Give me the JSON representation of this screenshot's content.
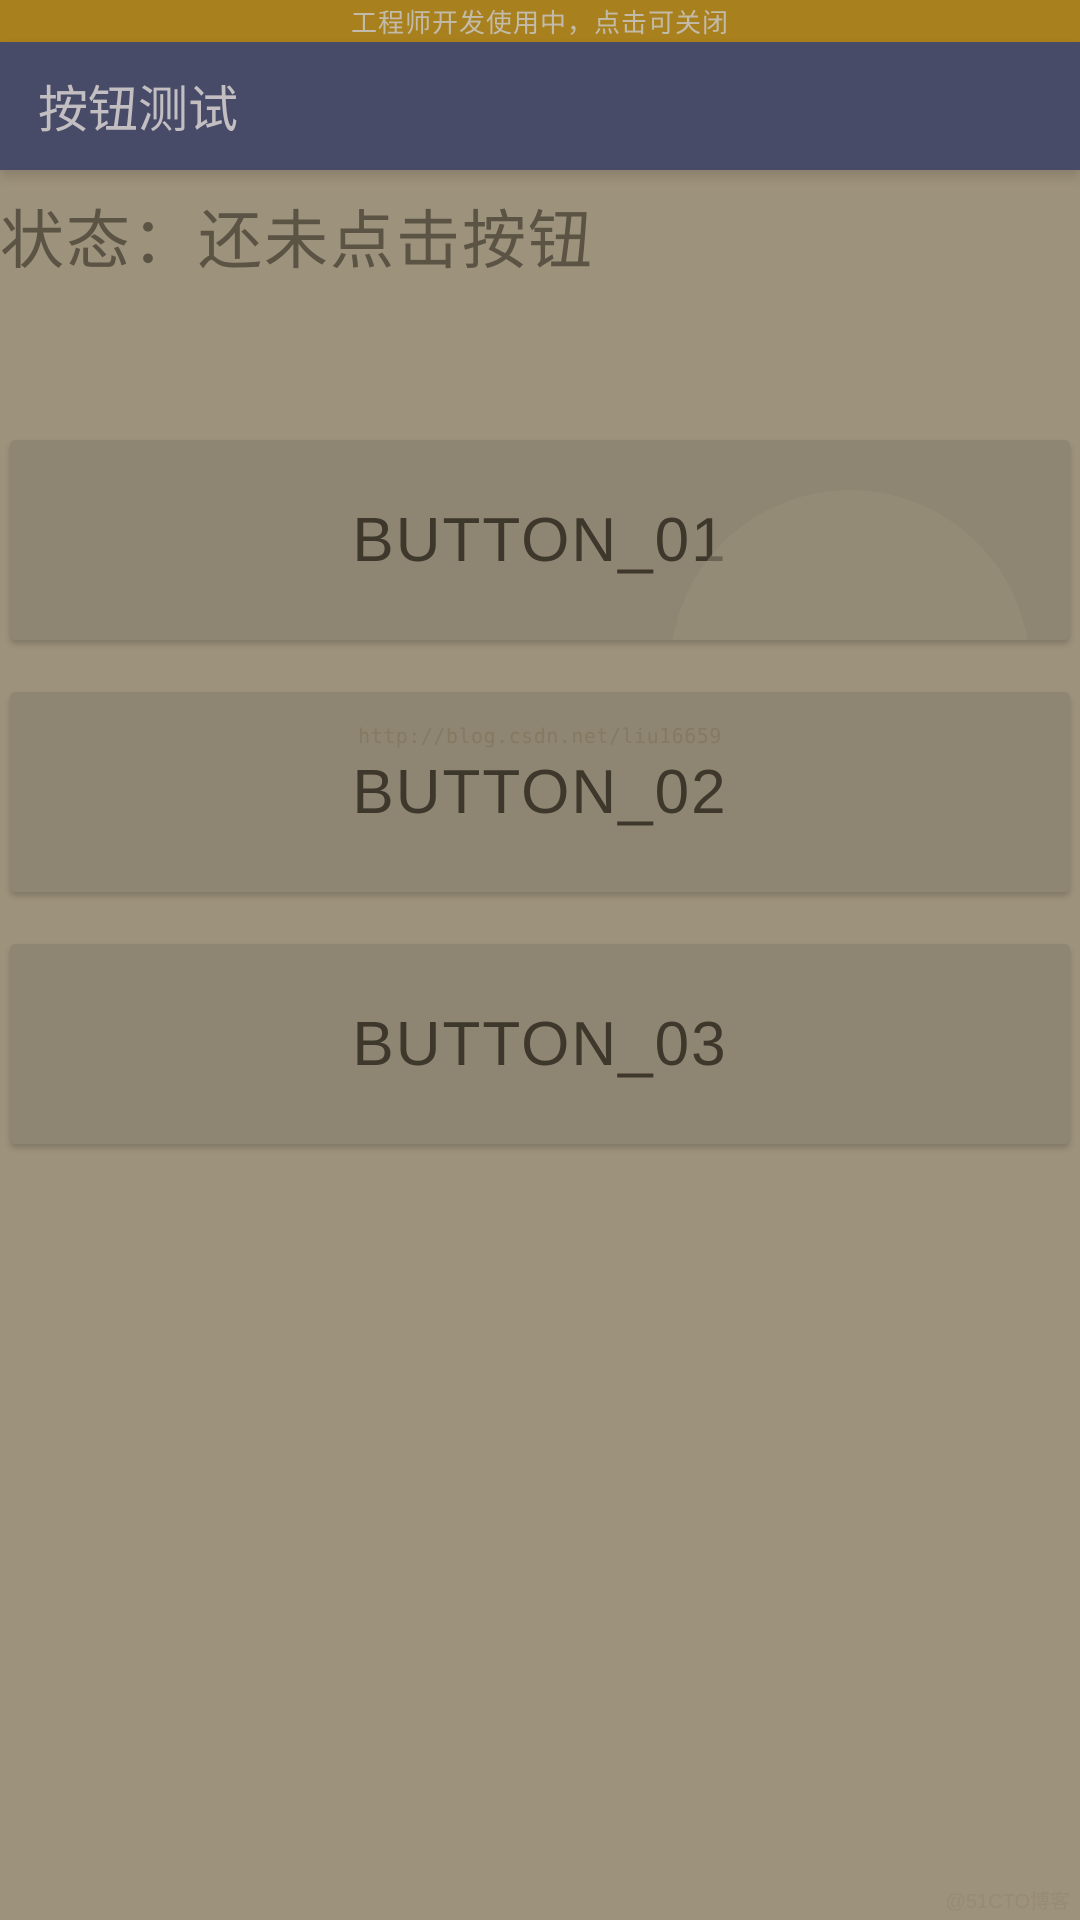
{
  "devBanner": {
    "text": "工程师开发使用中，点击可关闭"
  },
  "appBar": {
    "title": "按钮测试"
  },
  "status": {
    "text": "状态：还未点击按钮"
  },
  "buttons": [
    {
      "label": "BUTTON_01",
      "showRipple": true
    },
    {
      "label": "BUTTON_02",
      "showRipple": false
    },
    {
      "label": "BUTTON_03",
      "showRipple": false
    }
  ],
  "watermark": {
    "center": "http://blog.csdn.net/liu16659",
    "corner": "@51CTO博客"
  }
}
